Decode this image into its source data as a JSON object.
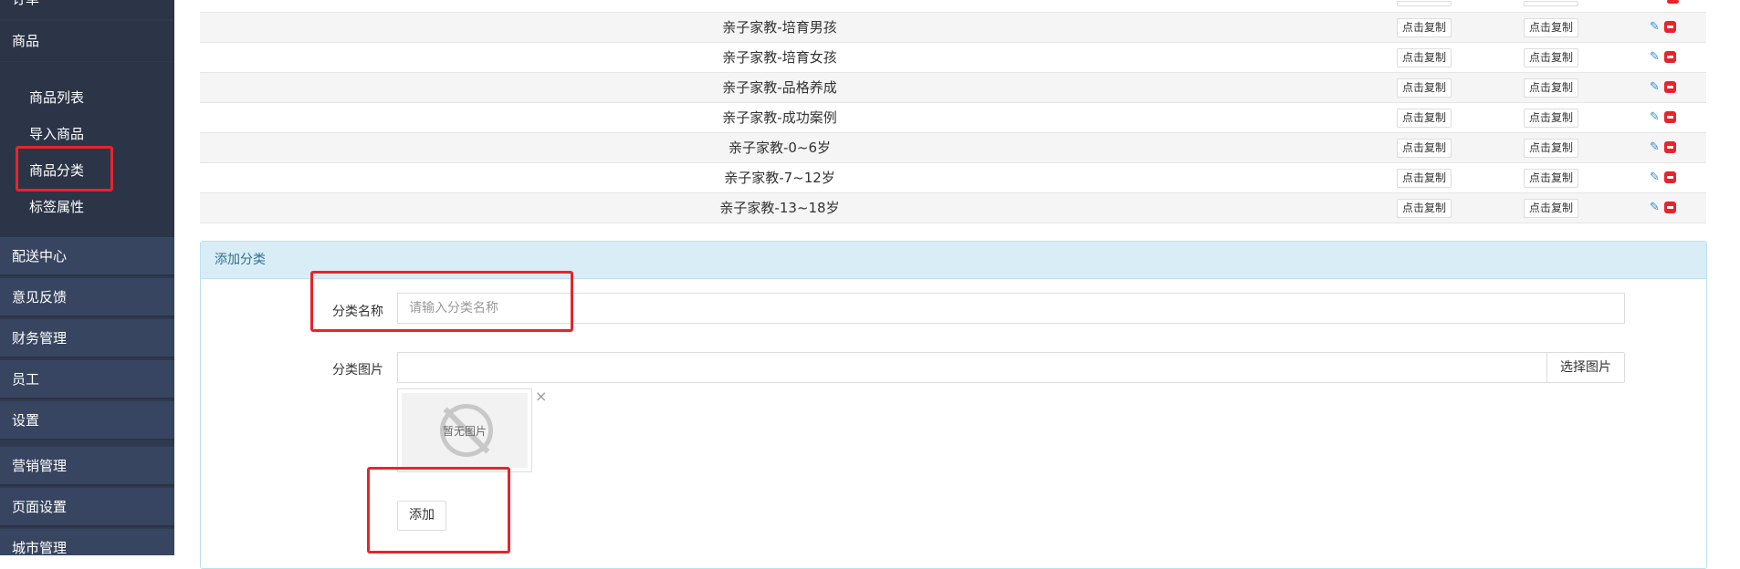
{
  "sidebar": {
    "items": [
      {
        "label": "订单"
      },
      {
        "label": "商品"
      },
      {
        "label": "配送中心"
      },
      {
        "label": "意见反馈"
      },
      {
        "label": "财务管理"
      },
      {
        "label": "员工"
      },
      {
        "label": "设置"
      },
      {
        "label": "营销管理"
      },
      {
        "label": "页面设置"
      },
      {
        "label": "城市管理"
      }
    ],
    "submenu": [
      {
        "label": "商品列表"
      },
      {
        "label": "导入商品"
      },
      {
        "label": "商品分类"
      },
      {
        "label": "标签属性"
      }
    ]
  },
  "table": {
    "rows": [
      {
        "name": "亲子家教-培育男孩",
        "copy1": "点击复制",
        "copy2": "点击复制"
      },
      {
        "name": "亲子家教-培育女孩",
        "copy1": "点击复制",
        "copy2": "点击复制"
      },
      {
        "name": "亲子家教-品格养成",
        "copy1": "点击复制",
        "copy2": "点击复制"
      },
      {
        "name": "亲子家教-成功案例",
        "copy1": "点击复制",
        "copy2": "点击复制"
      },
      {
        "name": "亲子家教-0~6岁",
        "copy1": "点击复制",
        "copy2": "点击复制"
      },
      {
        "name": "亲子家教-7~12岁",
        "copy1": "点击复制",
        "copy2": "点击复制"
      },
      {
        "name": "亲子家教-13~18岁",
        "copy1": "点击复制",
        "copy2": "点击复制"
      }
    ],
    "edit_icon": "edit-icon",
    "delete_icon": "delete-icon"
  },
  "form": {
    "title": "添加分类",
    "name_label": "分类名称",
    "name_placeholder": "请输入分类名称",
    "name_value": "",
    "image_label": "分类图片",
    "image_value": "",
    "choose_image_label": "选择图片",
    "no_image_text": "暂无图片",
    "close_symbol": "×",
    "submit_label": "添加"
  },
  "colors": {
    "sidebar_bg": "#2f3a4f",
    "highlight": "#e8242a",
    "panel_head_bg": "#d9edf7",
    "panel_head_text": "#31708f"
  }
}
